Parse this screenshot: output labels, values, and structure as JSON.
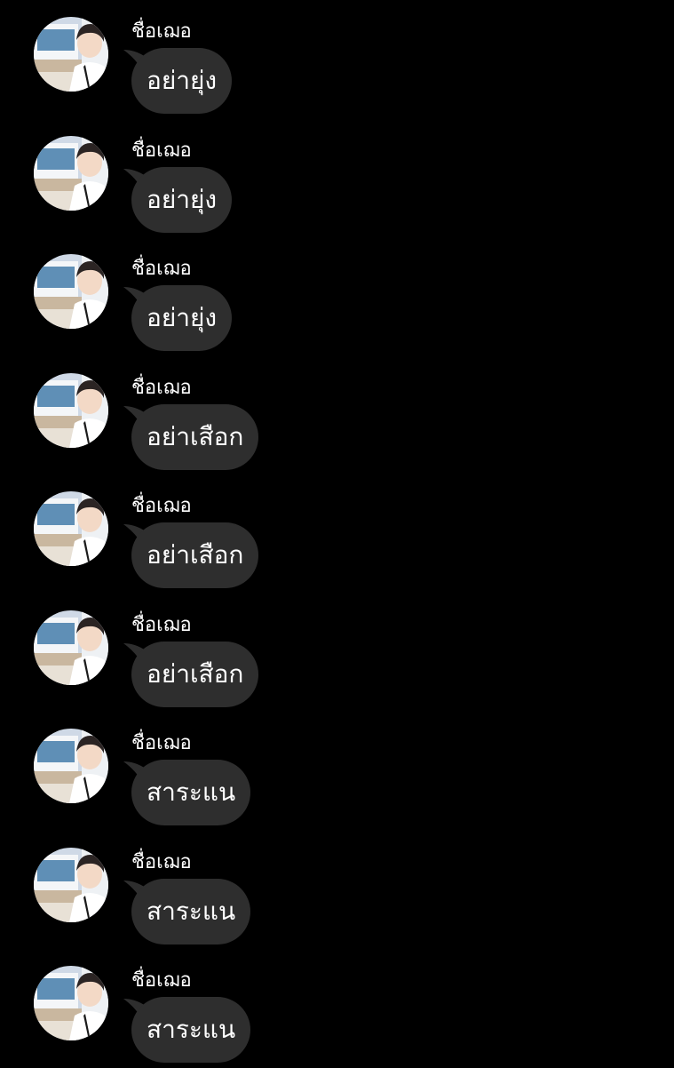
{
  "messages": [
    {
      "sender": "ชื่อเฌอ",
      "text": "อย่ายุ่ง"
    },
    {
      "sender": "ชื่อเฌอ",
      "text": "อย่ายุ่ง"
    },
    {
      "sender": "ชื่อเฌอ",
      "text": "อย่ายุ่ง"
    },
    {
      "sender": "ชื่อเฌอ",
      "text": "อย่าเสือก"
    },
    {
      "sender": "ชื่อเฌอ",
      "text": "อย่าเสือก"
    },
    {
      "sender": "ชื่อเฌอ",
      "text": "อย่าเสือก"
    },
    {
      "sender": "ชื่อเฌอ",
      "text": "สาระแน"
    },
    {
      "sender": "ชื่อเฌอ",
      "text": "สาระแน"
    },
    {
      "sender": "ชื่อเฌอ",
      "text": "สาระแน"
    }
  ],
  "colors": {
    "background": "#000000",
    "bubble": "#2e2e2e",
    "text": "#ffffff"
  },
  "avatar": {
    "icon": "profile-photo"
  }
}
